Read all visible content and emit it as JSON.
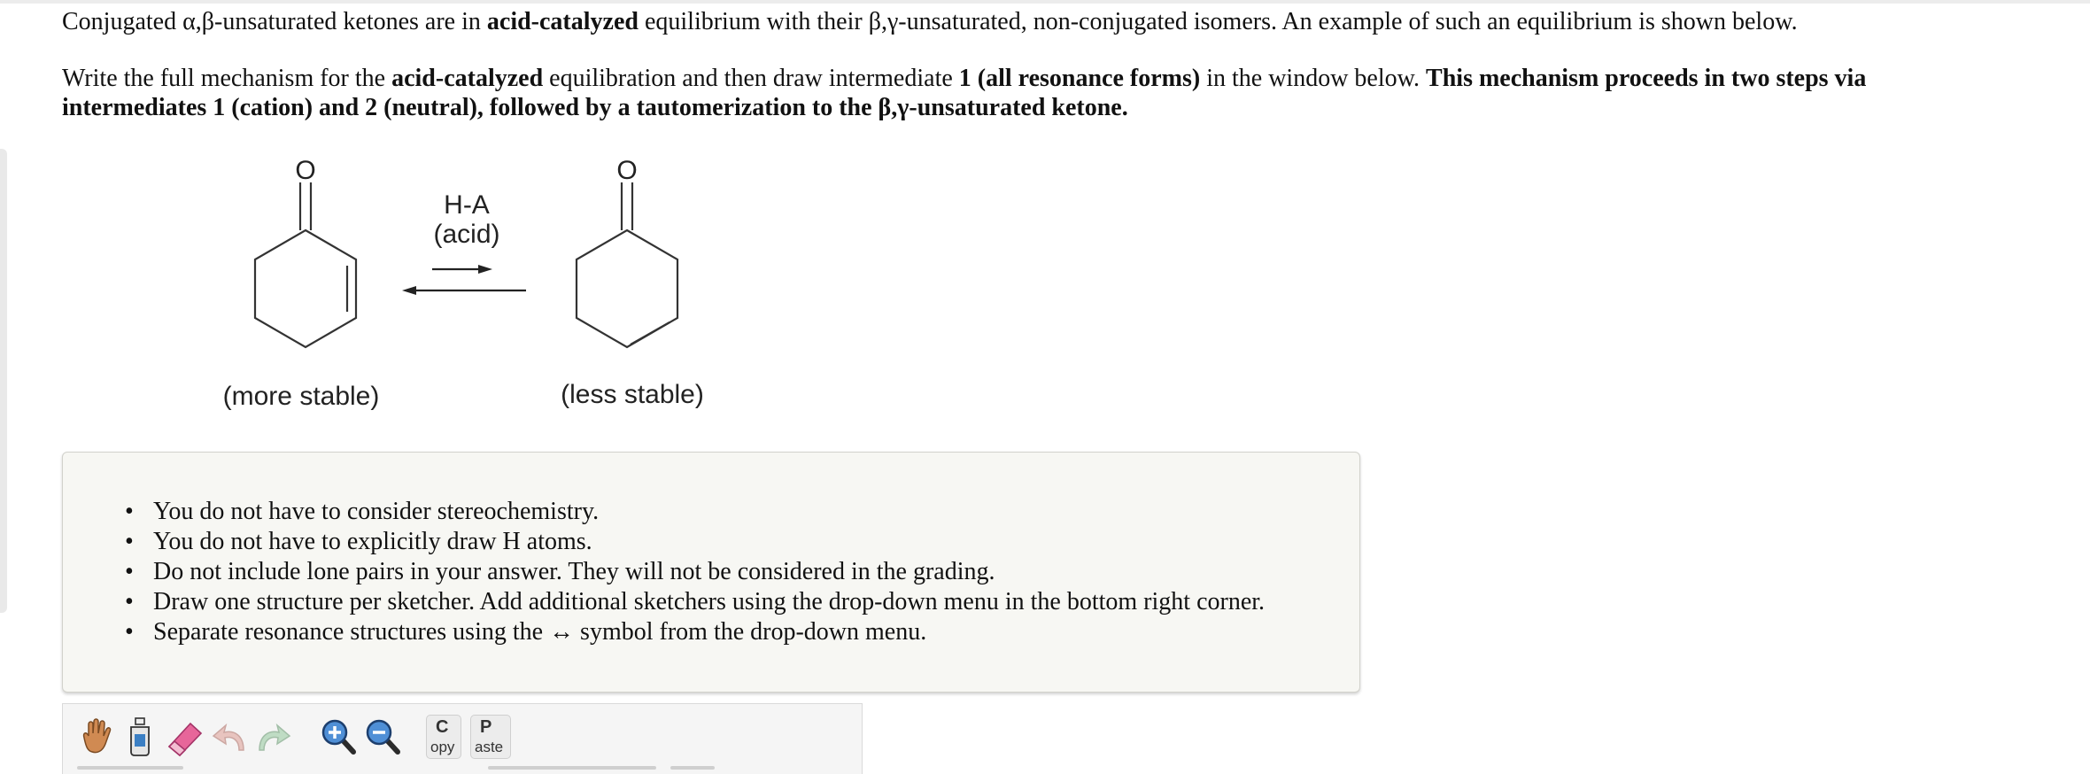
{
  "intro": {
    "s1": "Conjugated α,β-unsaturated ketones are in ",
    "s1_bold": "acid-catalyzed",
    "s1_end": " equilibrium with their β,γ-unsaturated, non-conjugated isomers. An example of such an equilibrium is shown below."
  },
  "instruction": {
    "a": "Write the full mechanism for the ",
    "a_bold": "acid-catalyzed",
    "b": " equilibration and then draw intermediate ",
    "b_bold": "1 (all resonance forms)",
    "c": " in the window below. ",
    "c_bold": "This mechanism proceeds in two steps via intermediates 1 (cation) and 2 (neutral), followed by a tautomerization to the β,γ-unsaturated ketone."
  },
  "scheme": {
    "left_atom": "O",
    "right_atom": "O",
    "reagent_line1": "H-A",
    "reagent_line2": "(acid)",
    "left_caption": "(more stable)",
    "right_caption": "(less stable)"
  },
  "notes": [
    "You do not have to consider stereochemistry.",
    "You do not have to explicitly draw H atoms.",
    "Do not include lone pairs in your answer. They will not be considered in the grading.",
    "Draw one structure per sketcher. Add additional sketchers using the drop-down menu in the bottom right corner.",
    "Separate resonance structures using the ↔ symbol from the drop-down menu."
  ],
  "toolbar": {
    "tools": [
      "hand-icon",
      "clear-bottle-icon",
      "eraser-icon",
      "undo-icon",
      "redo-icon",
      "zoom-in-icon",
      "zoom-out-icon"
    ],
    "copy_big": "C",
    "copy_small": "opy",
    "paste_big": "P",
    "paste_small": "aste"
  }
}
